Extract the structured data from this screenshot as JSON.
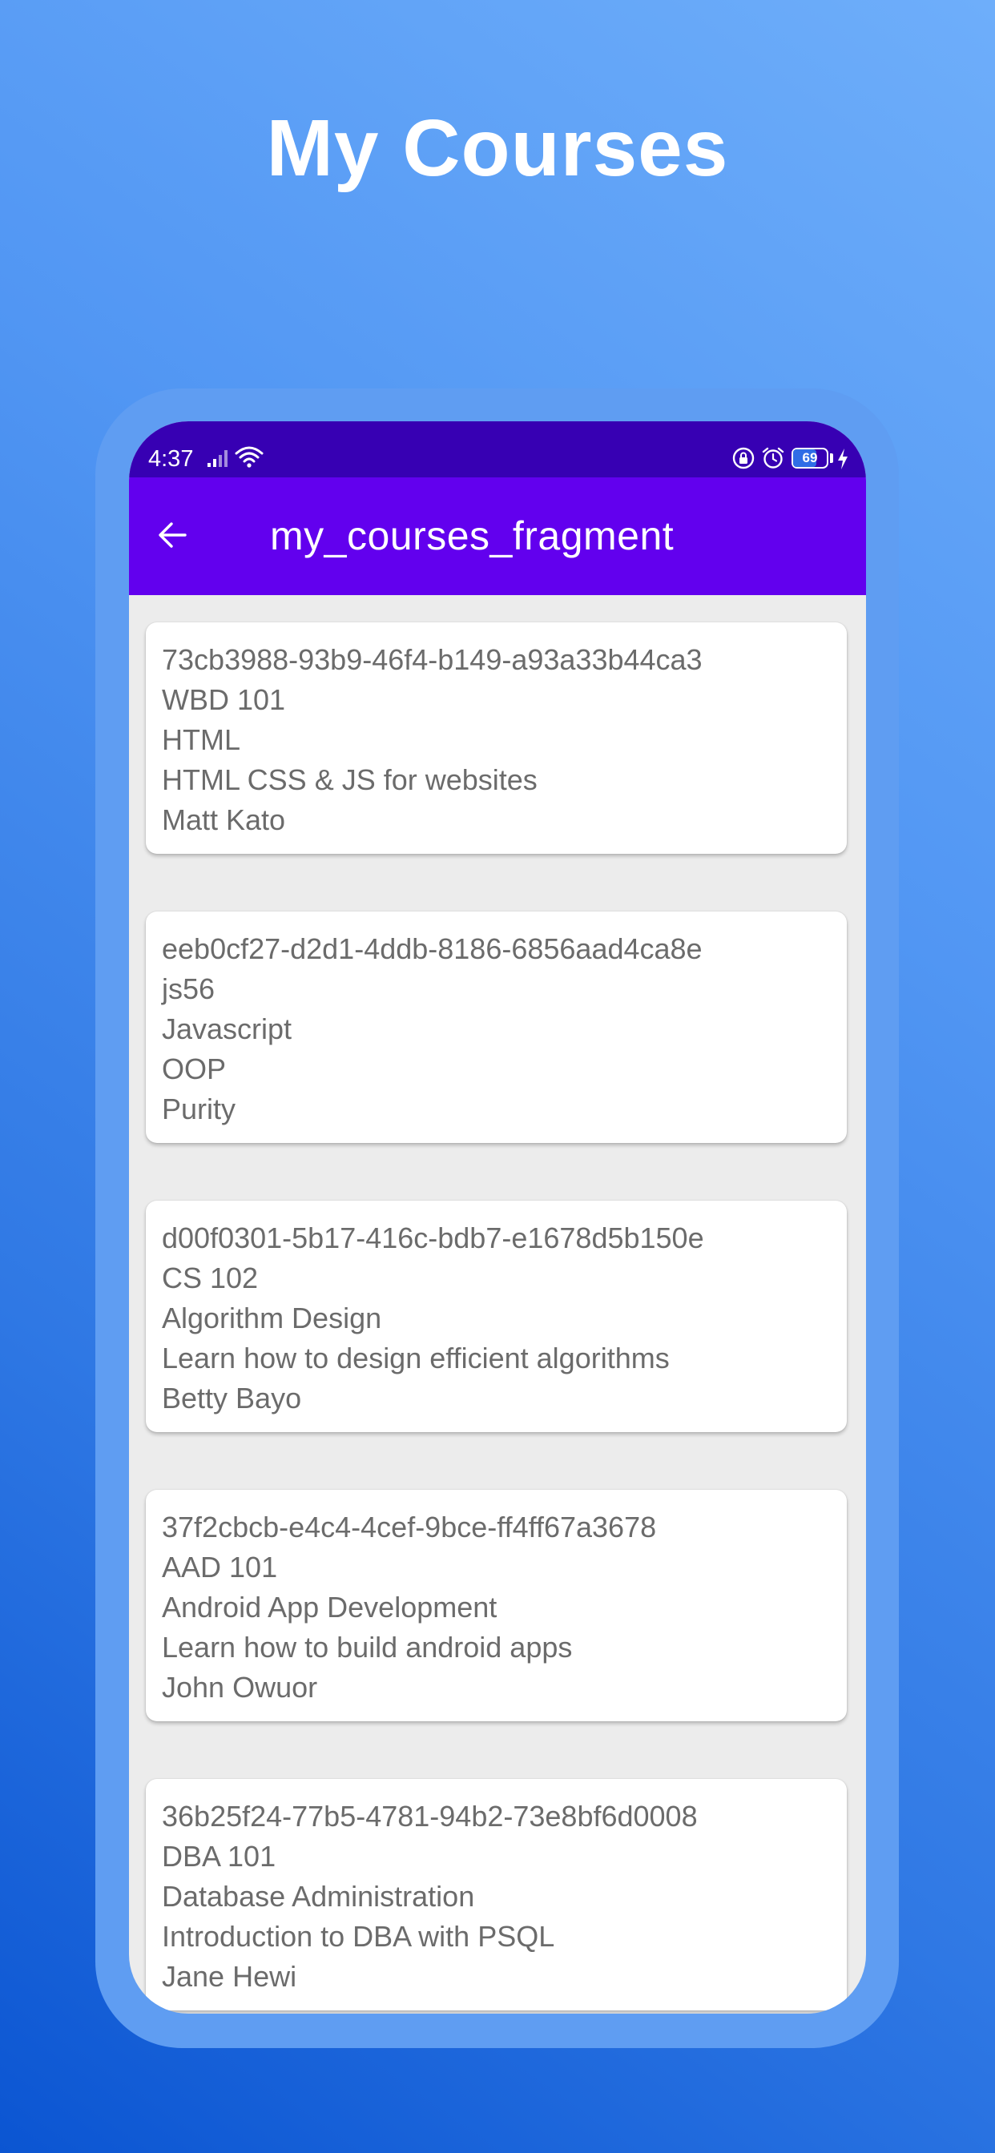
{
  "promo": {
    "title": "My Courses"
  },
  "status_bar": {
    "time": "4:37",
    "battery_level": "69",
    "battery_fraction": 0.69,
    "icons": [
      "signal-icon",
      "wifi-icon",
      "lock-icon",
      "alarm-icon",
      "battery-icon",
      "charging-icon"
    ]
  },
  "app_bar": {
    "title": "my_courses_fragment",
    "back_icon": "arrow-left-icon"
  },
  "courses": [
    {
      "id": "73cb3988-93b9-46f4-b149-a93a33b44ca3",
      "code": "WBD 101",
      "name": "HTML",
      "description": "HTML CSS & JS for websites",
      "instructor": "Matt Kato"
    },
    {
      "id": "eeb0cf27-d2d1-4ddb-8186-6856aad4ca8e",
      "code": "js56",
      "name": "Javascript",
      "description": "OOP",
      "instructor": "Purity"
    },
    {
      "id": "d00f0301-5b17-416c-bdb7-e1678d5b150e",
      "code": "CS 102",
      "name": "Algorithm Design",
      "description": "Learn how to design efficient algorithms",
      "instructor": "Betty Bayo"
    },
    {
      "id": "37f2cbcb-e4c4-4cef-9bce-ff4ff67a3678",
      "code": "AAD 101",
      "name": "Android App Development",
      "description": "Learn how to build android apps",
      "instructor": "John Owuor"
    },
    {
      "id": "36b25f24-77b5-4781-94b2-73e8bf6d0008",
      "code": "DBA 101",
      "name": "Database Administration",
      "description": "Introduction to DBA with PSQL",
      "instructor": "Jane Hewi"
    }
  ],
  "colors": {
    "status_bar": "#3700b3",
    "app_bar": "#6200ee",
    "list_background": "#ececec",
    "card_text": "#6b6b6b",
    "gradient_light": "#6eaefa",
    "gradient_dark": "#0b55d2"
  }
}
